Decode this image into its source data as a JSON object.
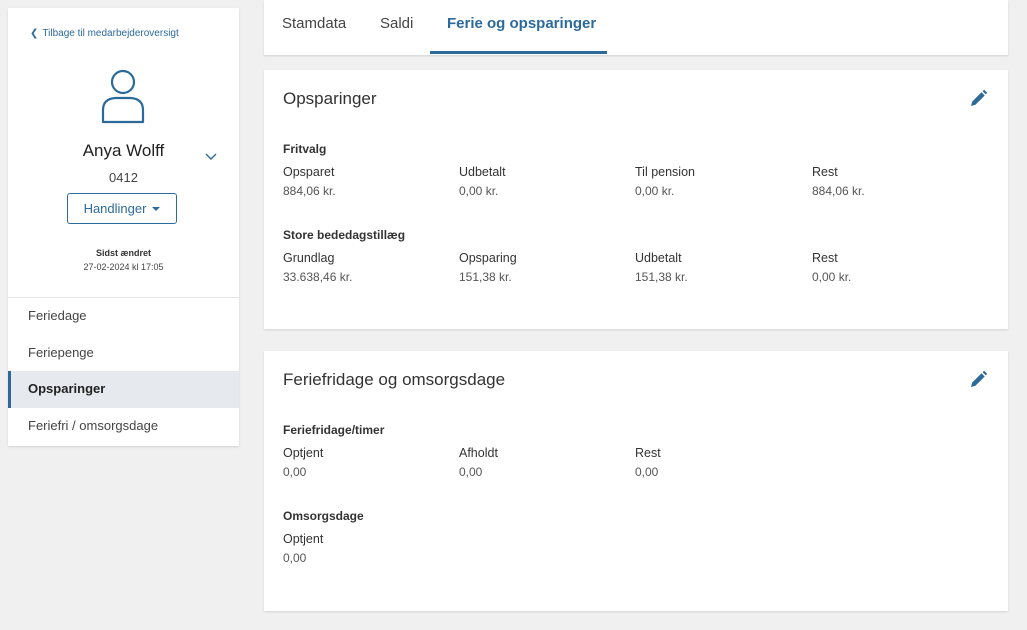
{
  "sidebar": {
    "back_link": "Tilbage til medarbejderoversigt",
    "employee_name": "Anya Wolff",
    "employee_number": "0412",
    "actions_label": "Handlinger",
    "last_changed_label": "Sidst ændret",
    "last_changed_value": "27-02-2024 kl 17:05",
    "nav": [
      {
        "label": "Feriedage"
      },
      {
        "label": "Feriepenge"
      },
      {
        "label": "Opsparinger"
      },
      {
        "label": "Feriefri / omsorgsdage"
      }
    ],
    "active_nav": "Opsparinger"
  },
  "tabs": [
    {
      "label": "Stamdata"
    },
    {
      "label": "Saldi"
    },
    {
      "label": "Ferie og opsparinger"
    }
  ],
  "active_tab": "Ferie og opsparinger",
  "opsparinger": {
    "title": "Opsparinger",
    "fritvalg": {
      "title": "Fritvalg",
      "fields": [
        {
          "label": "Opsparet",
          "value": "884,06 kr."
        },
        {
          "label": "Udbetalt",
          "value": "0,00 kr."
        },
        {
          "label": "Til pension",
          "value": "0,00 kr."
        },
        {
          "label": "Rest",
          "value": "884,06 kr."
        }
      ]
    },
    "store_bededag": {
      "title": "Store bededagstillæg",
      "fields": [
        {
          "label": "Grundlag",
          "value": "33.638,46 kr."
        },
        {
          "label": "Opsparing",
          "value": "151,38 kr."
        },
        {
          "label": "Udbetalt",
          "value": "151,38 kr."
        },
        {
          "label": "Rest",
          "value": "0,00 kr."
        }
      ]
    }
  },
  "feriefridage": {
    "title": "Feriefridage og omsorgsdage",
    "timer": {
      "title": "Feriefridage/timer",
      "fields": [
        {
          "label": "Optjent",
          "value": "0,00"
        },
        {
          "label": "Afholdt",
          "value": "0,00"
        },
        {
          "label": "Rest",
          "value": "0,00"
        }
      ]
    },
    "omsorgsdage": {
      "title": "Omsorgsdage",
      "fields": [
        {
          "label": "Optjent",
          "value": "0,00"
        }
      ]
    }
  },
  "colors": {
    "accent": "#2c6a9c",
    "page_background": "#f0f0f0",
    "card_background": "#ffffff",
    "active_nav_background": "#e6eaee"
  },
  "icons": [
    "chevron-left-icon",
    "user-avatar-icon",
    "chevron-down-icon",
    "caret-down-icon",
    "pencil-icon"
  ]
}
